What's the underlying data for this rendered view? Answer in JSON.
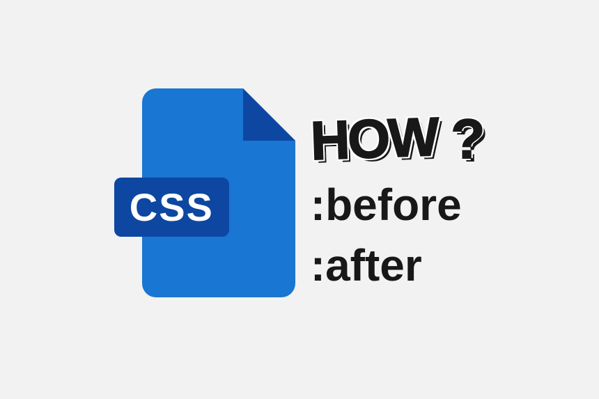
{
  "file_label": "CSS",
  "heading": {
    "word": "HOW",
    "mark": "?"
  },
  "lines": {
    "before": ":before",
    "after": ":after"
  }
}
